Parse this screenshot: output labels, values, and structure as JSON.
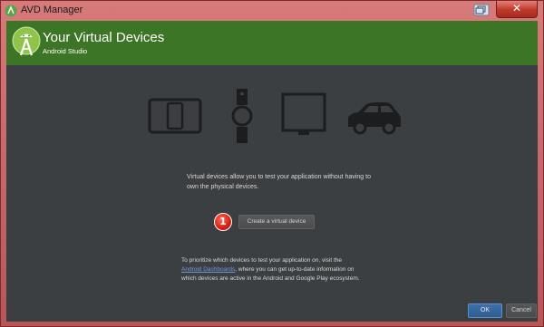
{
  "window": {
    "title": "AVD Manager",
    "close_glyph": "✕"
  },
  "header": {
    "title": "Your Virtual Devices",
    "subtitle": "Android Studio",
    "logo_icon": "android-studio-logo-icon",
    "background_color": "#3c7525"
  },
  "illustration": {
    "icons": [
      "tablet-phone-icon",
      "watch-icon",
      "tv-icon",
      "car-icon"
    ]
  },
  "intro": {
    "line1": "Virtual devices allow you to test your application without having to",
    "line2": "own the physical devices."
  },
  "actions": {
    "step_number": "1",
    "create_label": "Create a virtual device"
  },
  "info": {
    "line1": "To prioritize which devices to test your application on, visit the",
    "link": "Android Dashboards",
    "line2_rest": ", where you can get up-to-date information on",
    "line3": "which devices are active in the Android and Google Play ecosystem."
  },
  "footer": {
    "ok_label": "OK",
    "cancel_label": "Cancel"
  },
  "colors": {
    "accent_blue": "#2f5d93",
    "link": "#6d9bdc",
    "badge_red": "#d61f10"
  }
}
